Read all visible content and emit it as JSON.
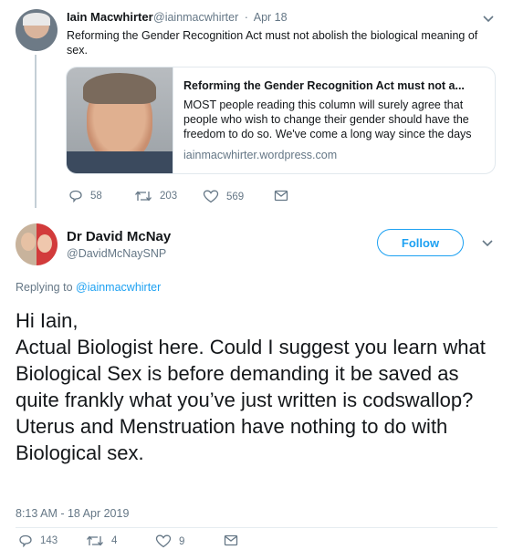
{
  "parent_tweet": {
    "author_name": "Iain Macwhirter",
    "handle": "@iainmacwhirter",
    "separator": "·",
    "date": "Apr 18",
    "text": "Reforming the Gender Recognition Act must not abolish the biological meaning of sex.",
    "card": {
      "title": "Reforming the Gender Recognition Act must not a...",
      "description": "MOST people reading this column will surely agree that people who wish to change their gender should have the freedom to do so. We've come a long way since the days",
      "domain": "iainmacwhirter.wordpress.com"
    },
    "actions": {
      "replies": "58",
      "retweets": "203",
      "likes": "569"
    }
  },
  "main_tweet": {
    "author_name": "Dr David McNay",
    "handle": "@DavidMcNaySNP",
    "follow_label": "Follow",
    "replying_prefix": "Replying to",
    "replying_handle": "@iainmacwhirter",
    "text": "Hi Iain,\nActual Biologist here. Could I suggest you learn what Biological Sex is before demanding it be saved as quite frankly what you’ve just written is codswallop?\nUterus and Menstruation have nothing to do with Biological sex.",
    "timestamp": "8:13 AM - 18 Apr 2019",
    "actions": {
      "replies": "143",
      "retweets": "4",
      "likes": "9"
    }
  },
  "colors": {
    "accent": "#1da1f2",
    "muted": "#657786",
    "border": "#e1e8ed"
  },
  "icons": [
    "reply-icon",
    "retweet-icon",
    "like-icon",
    "direct-message-icon",
    "chevron-down-icon"
  ]
}
